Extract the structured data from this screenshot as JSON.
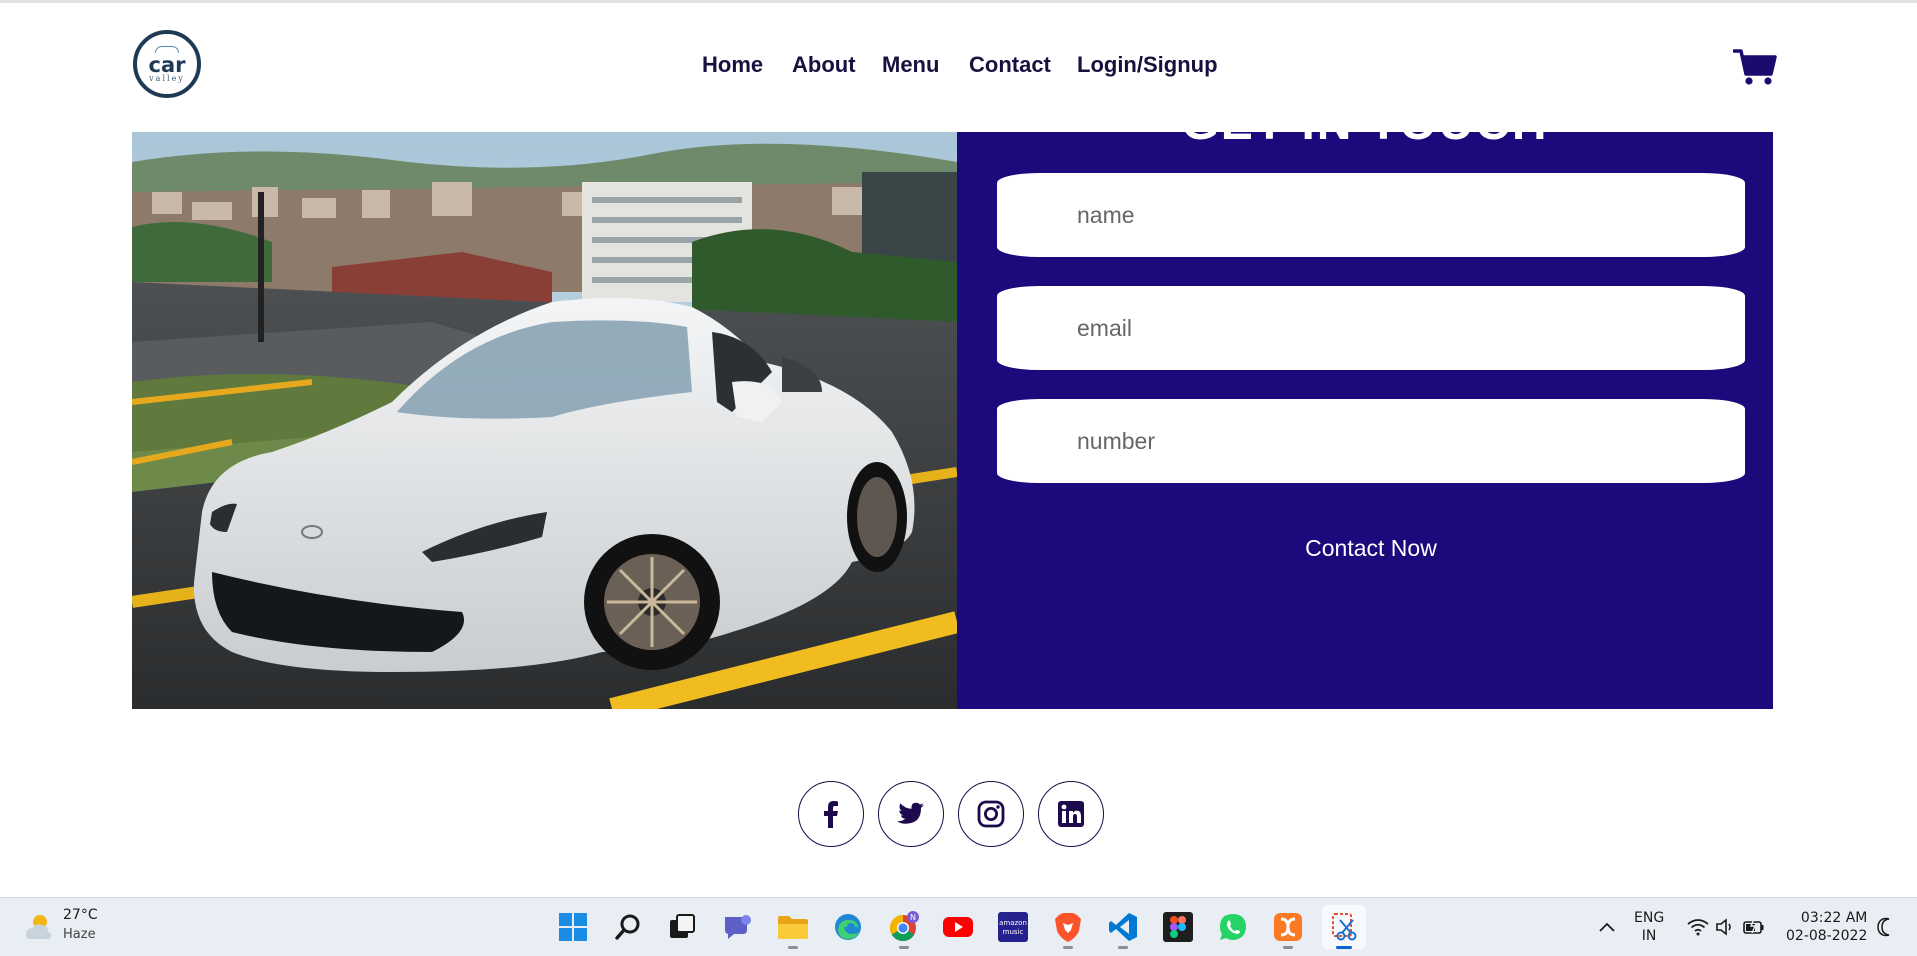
{
  "header": {
    "logo_word": "car",
    "logo_sub": "valley",
    "nav": [
      "Home",
      "About",
      "Menu",
      "Contact",
      "Login/Signup"
    ]
  },
  "hero": {
    "heading": "GET IN TOUCH",
    "form": {
      "name_placeholder": "name",
      "email_placeholder": "email",
      "number_placeholder": "number",
      "submit_label": "Contact Now"
    }
  },
  "social": [
    "facebook-icon",
    "twitter-icon",
    "instagram-icon",
    "linkedin-icon"
  ],
  "taskbar": {
    "weather_temp": "27°C",
    "weather_condition": "Haze",
    "lang_top": "ENG",
    "lang_bottom": "IN",
    "time": "03:22 AM",
    "date": "02-08-2022",
    "chrome_badge": "N",
    "amazon_music_line1": "amazon",
    "amazon_music_line2": "music"
  },
  "colors": {
    "panel": "#1c0a7c",
    "nav_text": "#1a1040",
    "cart": "#1c0a6e"
  }
}
